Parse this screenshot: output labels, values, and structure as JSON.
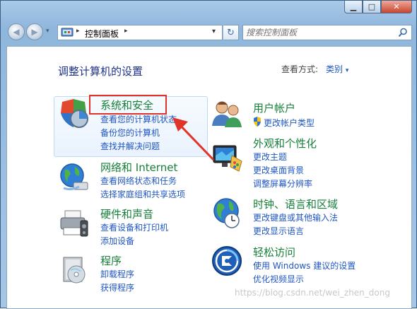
{
  "window": {
    "minimize_glyph": "▁",
    "maximize_glyph": "□",
    "close_glyph": "✕"
  },
  "nav": {
    "back_glyph": "◀",
    "forward_glyph": "▶",
    "address_sep": "▸",
    "address_text": "控制面板",
    "address_sep2": "▸",
    "dropdown_glyph": "▾",
    "refresh_glyph": "↻",
    "search_placeholder": "搜索控制面板"
  },
  "main": {
    "title": "调整计算机的设置",
    "view_by_label": "查看方式:",
    "view_by_value": "类别"
  },
  "categories": [
    {
      "heading": "系统和安全",
      "links": [
        "查看您的计算机状态",
        "备份您的计算机",
        "查找并解决问题"
      ]
    },
    {
      "heading": "网络和 Internet",
      "links": [
        "查看网络状态和任务",
        "选择家庭组和共享选项"
      ]
    },
    {
      "heading": "硬件和声音",
      "links": [
        "查看设备和打印机",
        "添加设备"
      ]
    },
    {
      "heading": "程序",
      "links": [
        "卸载程序",
        "获得程序"
      ]
    },
    {
      "heading": "用户帐户",
      "links": [
        "更改帐户类型"
      ]
    },
    {
      "heading": "外观和个性化",
      "links": [
        "更改主题",
        "更改桌面背景",
        "调整屏幕分辨率"
      ]
    },
    {
      "heading": "时钟、语言和区域",
      "links": [
        "更改键盘或其他输入法",
        "更改显示语言"
      ]
    },
    {
      "heading": "轻松访问",
      "links": [
        "使用 Windows 建议的设置",
        "优化视频显示"
      ]
    }
  ],
  "watermark": "https://blog.csdn.net/wei_zhen_dong",
  "colors": {
    "heading": "#16803a",
    "link": "#1f56c4",
    "title": "#1e3287",
    "highlight": "#e0332a"
  }
}
